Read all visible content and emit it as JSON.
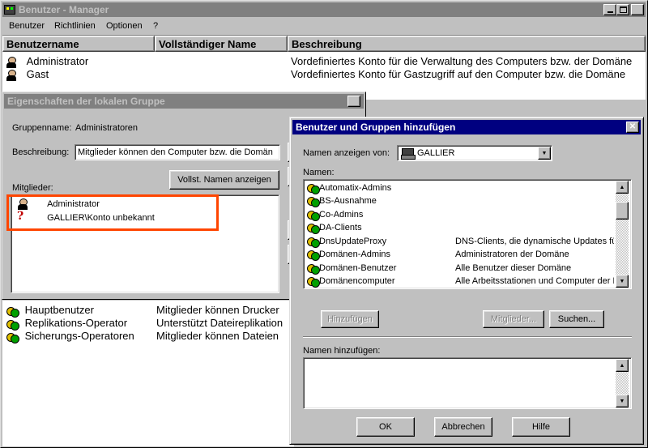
{
  "main": {
    "title": "Benutzer - Manager",
    "menu": [
      "Benutzer",
      "Richtlinien",
      "Optionen",
      "?"
    ],
    "columns": [
      "Benutzername",
      "Vollständiger Name",
      "Beschreibung"
    ],
    "users": [
      {
        "name": "Administrator",
        "full": "",
        "desc": "Vordefiniertes Konto für die Verwaltung des Computers bzw. der Domäne"
      },
      {
        "name": "Gast",
        "full": "",
        "desc": "Vordefiniertes Konto für Gastzugriff auf den Computer bzw. die Domäne"
      }
    ],
    "groups": [
      {
        "name": "Hauptbenutzer",
        "desc": "Mitglieder können Drucker"
      },
      {
        "name": "Replikations-Operator",
        "desc": "Unterstützt Dateireplikation"
      },
      {
        "name": "Sicherungs-Operatoren",
        "desc": "Mitglieder können Dateien"
      }
    ]
  },
  "group_props": {
    "title": "Eigenschaften der lokalen Gruppe",
    "group_name_label": "Gruppenname:",
    "group_name_value": "Administratoren",
    "desc_label": "Beschreibung:",
    "desc_value": "Mitglieder können den Computer bzw. die Domän",
    "members_label": "Mitglieder:",
    "show_names_button": "Vollst. Namen anzeigen",
    "members": [
      "Administrator",
      "GALLIER\\Konto unbekannt"
    ]
  },
  "add_dialog": {
    "title": "Benutzer und Gruppen hinzufügen",
    "show_from_label": "Namen anzeigen von:",
    "show_from_value": "GALLIER",
    "names_label": "Namen:",
    "names": [
      {
        "name": "Automatix-Admins",
        "desc": "",
        "icon": "group-icon"
      },
      {
        "name": "BS-Ausnahme",
        "desc": "",
        "icon": "group-icon"
      },
      {
        "name": "Co-Admins",
        "desc": "",
        "icon": "group-icon"
      },
      {
        "name": "DA-Clients",
        "desc": "",
        "icon": "group-icon"
      },
      {
        "name": "DnsUpdateProxy",
        "desc": "DNS-Clients, die dynamische Updates fü",
        "icon": "group-icon"
      },
      {
        "name": "Domänen-Admins",
        "desc": "Administratoren der Domäne",
        "icon": "group-icon"
      },
      {
        "name": "Domänen-Benutzer",
        "desc": "Alle Benutzer dieser Domäne",
        "icon": "group-icon"
      },
      {
        "name": "Domänencomputer",
        "desc": "Alle Arbeitsstationen und Computer der D",
        "icon": "group-icon"
      }
    ],
    "add_button": "Hinzufügen",
    "members_button": "Mitglieder...",
    "search_button": "Suchen...",
    "add_names_label": "Namen hinzufügen:",
    "ok_button": "OK",
    "cancel_button": "Abbrechen",
    "help_button": "Hilfe"
  },
  "colors": {
    "highlight_box": "#ff4500",
    "title_active": "#000080",
    "title_inactive": "#808080"
  }
}
